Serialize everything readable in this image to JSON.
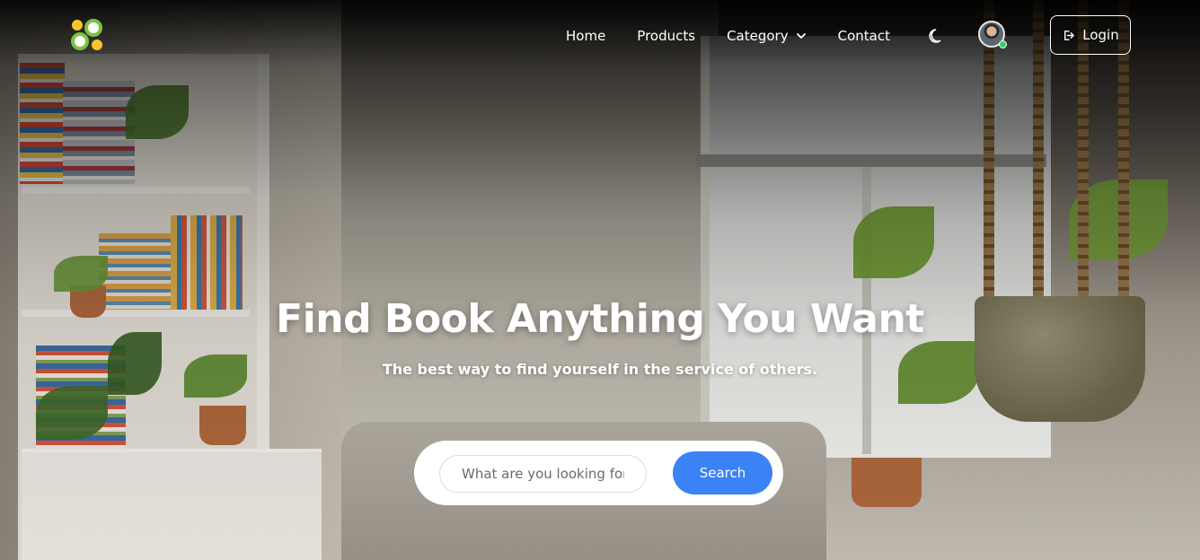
{
  "nav": {
    "logo_icon": "logo-icon",
    "links": [
      {
        "label": "Home"
      },
      {
        "label": "Products"
      },
      {
        "label": "Category",
        "icon": "chevron-down-icon"
      },
      {
        "label": "Contact"
      }
    ],
    "theme_toggle_icon": "moon-icon",
    "avatar_status": "online",
    "login_label": "Login",
    "login_icon": "login-icon"
  },
  "hero": {
    "title": "Find Book Anything You Want",
    "subtitle": "The best way to find yourself in the service of others.",
    "search": {
      "placeholder": "What are you looking for",
      "value": "",
      "button_label": "Search"
    }
  },
  "colors": {
    "accent": "#3b82f6",
    "text_on_image": "#ffffff",
    "status_online": "#2fcf6b",
    "logo_yellow": "#f7c52b",
    "logo_green": "#7cc242"
  }
}
